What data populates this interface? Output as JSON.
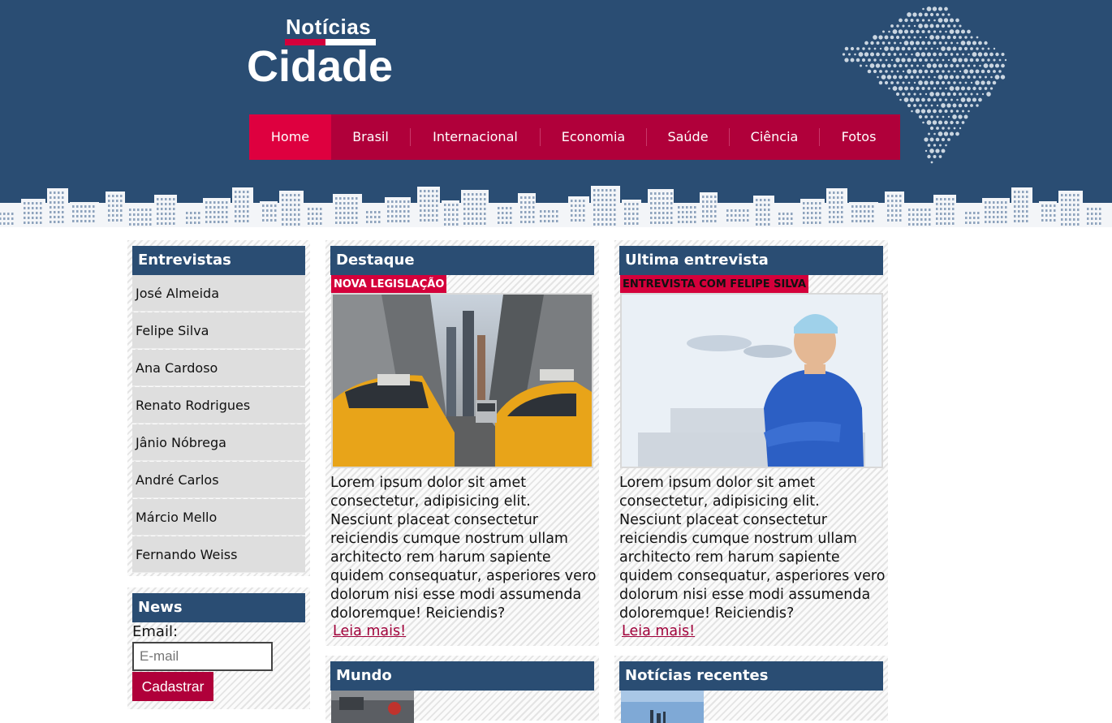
{
  "logo": {
    "top": "Notícias",
    "main": "Cidade"
  },
  "nav": {
    "items": [
      {
        "label": "Home",
        "active": true
      },
      {
        "label": "Brasil"
      },
      {
        "label": "Internacional"
      },
      {
        "label": "Economia"
      },
      {
        "label": "Saúde"
      },
      {
        "label": "Ciência"
      },
      {
        "label": "Fotos"
      }
    ]
  },
  "sidebar": {
    "title": "Entrevistas",
    "items": [
      "José Almeida",
      "Felipe Silva",
      "Ana Cardoso",
      "Renato Rodrigues",
      "Jânio Nóbrega",
      "André Carlos",
      "Márcio Mello",
      "Fernando Weiss"
    ]
  },
  "newsletter": {
    "title": "News",
    "label": "Email:",
    "placeholder": "E-mail",
    "button": "Cadastrar"
  },
  "featured": {
    "title": "Destaque",
    "tag": "NOVA LEGISLAÇÃO",
    "text": "Lorem ipsum dolor sit amet consectetur, adipisicing elit. Nesciunt placeat consectetur reiciendis cumque nostrum ullam architecto rem harum sapiente quidem consequatur, asperiores vero dolorum nisi esse modi assumenda doloremque! Reiciendis?",
    "more": "Leia mais!"
  },
  "interview": {
    "title": "Ultima entrevista",
    "tag": "ENTREVISTA COM FELIPE SILVA",
    "text": "Lorem ipsum dolor sit amet consectetur, adipisicing elit. Nesciunt placeat consectetur reiciendis cumque nostrum ullam architecto rem harum sapiente quidem consequatur, asperiores vero dolorum nisi esse modi assumenda doloremque! Reiciendis?",
    "more": "Leia mais!"
  },
  "world": {
    "title": "Mundo"
  },
  "recent": {
    "title": "Notícias recentes"
  },
  "colors": {
    "navy": "#2a4d73",
    "crimson": "#b0003a",
    "active": "#de003f"
  }
}
